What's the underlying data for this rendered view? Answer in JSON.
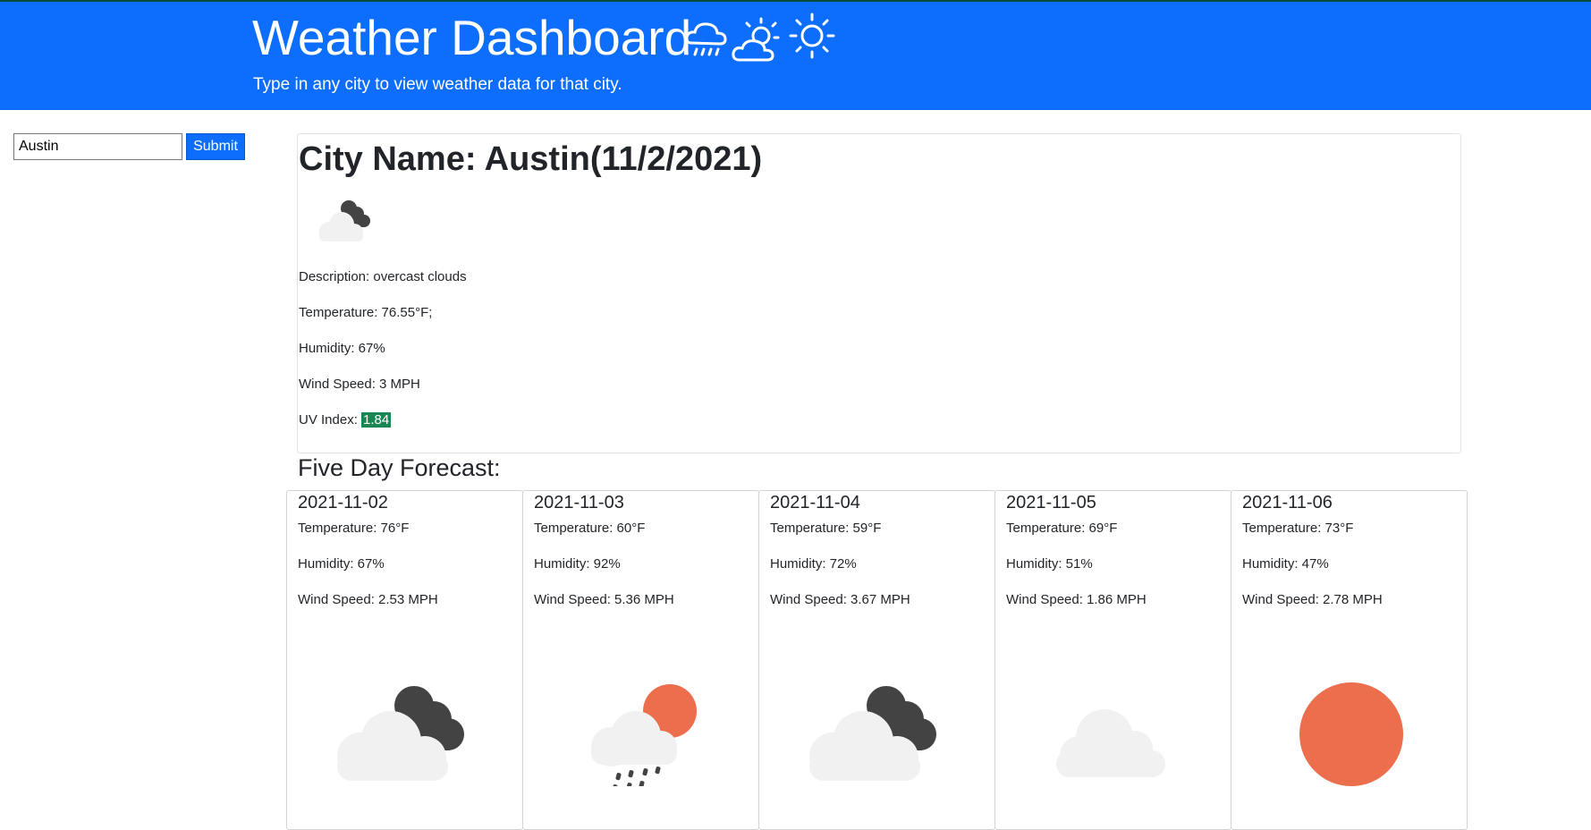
{
  "header": {
    "title": "Weather Dashboard",
    "subtitle": "Type in any city to view weather data for that city.",
    "icons": [
      "rain-cloud-icon",
      "partly-sunny-icon",
      "sun-icon"
    ]
  },
  "search": {
    "value": "Austin",
    "submit_label": "Submit"
  },
  "current": {
    "title": "City Name: Austin(11/2/2021)",
    "icon": "overcast-clouds-icon",
    "description": "Description: overcast clouds",
    "temperature": "Temperature: 76.55°F;",
    "humidity": "Humidity: 67%",
    "wind": "Wind Speed: 3 MPH",
    "uv_label": "UV Index: ",
    "uv_value": "1.84",
    "uv_color": "#198754"
  },
  "forecast": {
    "title": "Five Day Forecast:",
    "days": [
      {
        "date": "2021-11-02",
        "temp": "Temperature: 76°F",
        "humidity": "Humidity: 67%",
        "wind": "Wind Speed: 2.53 MPH",
        "icon": "overcast-clouds-icon"
      },
      {
        "date": "2021-11-03",
        "temp": "Temperature: 60°F",
        "humidity": "Humidity: 92%",
        "wind": "Wind Speed: 5.36 MPH",
        "icon": "sun-rain-cloud-icon"
      },
      {
        "date": "2021-11-04",
        "temp": "Temperature: 59°F",
        "humidity": "Humidity: 72%",
        "wind": "Wind Speed: 3.67 MPH",
        "icon": "overcast-clouds-icon"
      },
      {
        "date": "2021-11-05",
        "temp": "Temperature: 69°F",
        "humidity": "Humidity: 51%",
        "wind": "Wind Speed: 1.86 MPH",
        "icon": "cloud-icon"
      },
      {
        "date": "2021-11-06",
        "temp": "Temperature: 73°F",
        "humidity": "Humidity: 47%",
        "wind": "Wind Speed: 2.78 MPH",
        "icon": "sun-icon"
      }
    ]
  },
  "colors": {
    "header_bg": "#0d6efd",
    "sun": "#ec6e4c",
    "dark_cloud": "#434343",
    "light_cloud": "#f1f1f1"
  }
}
